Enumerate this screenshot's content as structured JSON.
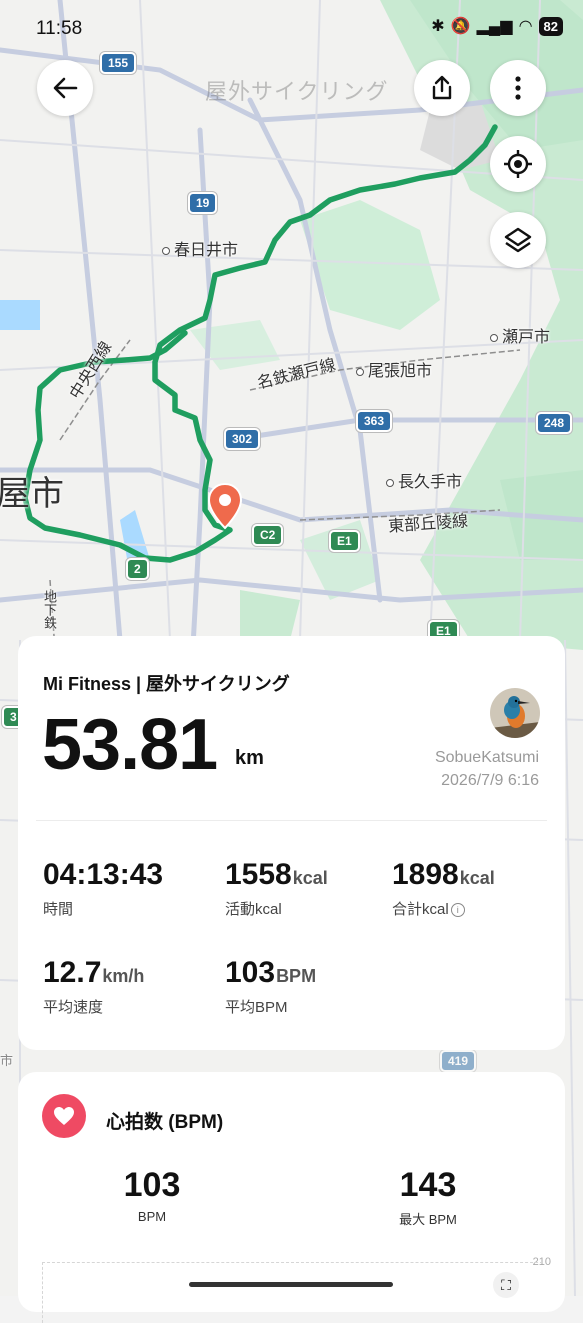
{
  "status_bar": {
    "time": "11:58",
    "battery": "82"
  },
  "map": {
    "title": "屋外サイクリング",
    "labels": {
      "kasugai": "春日井市",
      "seto": "瀬戸市",
      "meitetsu_seto": "名鉄瀬戸線",
      "owari_asahi": "尾張旭市",
      "chuo_west": "中央西線",
      "nagakute": "長久手市",
      "tobu_kyuryo": "東部丘陵線",
      "city_edge": "屋市",
      "subway": "地下鉄",
      "shi": "市"
    },
    "shields": {
      "r155": "155",
      "r19": "19",
      "r302": "302",
      "r363": "363",
      "r248": "248",
      "c2": "C2",
      "e1": "E1",
      "r2": "2",
      "e1b": "E1",
      "r3": "3",
      "r419": "419"
    }
  },
  "workout": {
    "app_title": "Mi Fitness | 屋外サイクリング",
    "distance": "53.81",
    "distance_unit": "km",
    "user": "SobueKatsumi",
    "date": "2026/7/9 6:16",
    "stats": [
      {
        "value": "04:13:43",
        "unit": "",
        "label": "時間"
      },
      {
        "value": "1558",
        "unit": "kcal",
        "label": "活動kcal"
      },
      {
        "value": "1898",
        "unit": "kcal",
        "label": "合計kcal"
      },
      {
        "value": "12.7",
        "unit": "km/h",
        "label": "平均速度"
      },
      {
        "value": "103",
        "unit": "BPM",
        "label": "平均BPM"
      }
    ]
  },
  "heart_rate": {
    "title": "心拍数 (BPM)",
    "avg": "103",
    "avg_label": "BPM",
    "max": "143",
    "max_label": "最大 BPM",
    "axis_max": "210"
  },
  "colors": {
    "route": "#1f9e5f",
    "pin": "#ef6a4c",
    "heart": "#ef4a63"
  },
  "icons": [
    "back-arrow-icon",
    "share-icon",
    "more-vertical-icon",
    "locate-icon",
    "layers-icon",
    "pin-icon",
    "heart-icon",
    "expand-icon"
  ]
}
